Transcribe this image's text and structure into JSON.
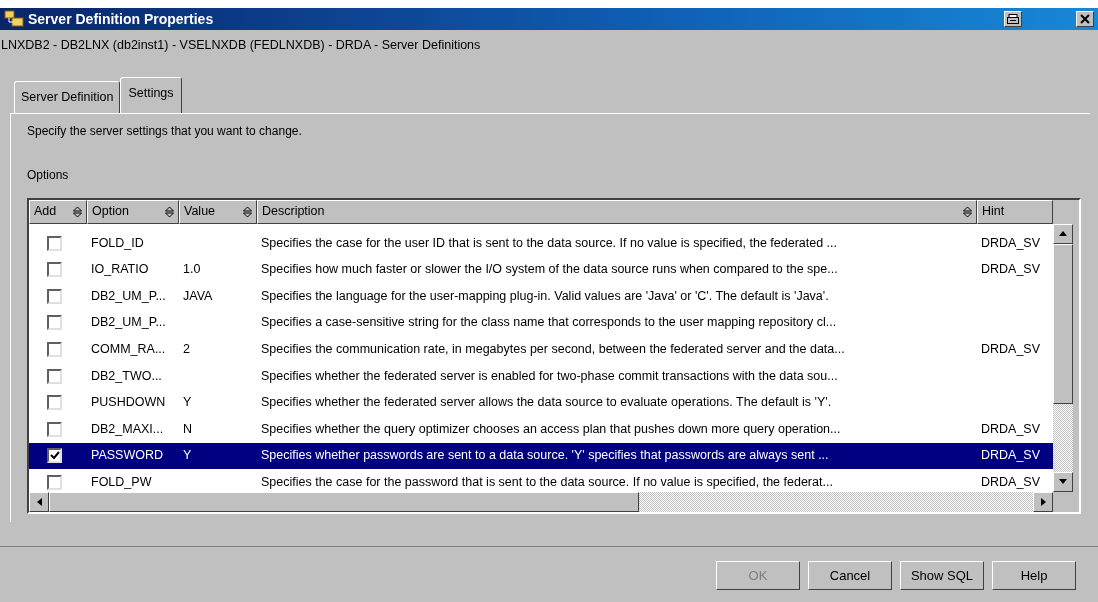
{
  "window": {
    "title": "Server Definition Properties",
    "subtitle": "LNXDB2 - DB2LNX (db2inst1)  - VSELNXDB (FEDLNXDB) - DRDA - Server Definitions"
  },
  "tabs": [
    {
      "label": "Server Definition",
      "selected": false
    },
    {
      "label": "Settings",
      "selected": true
    }
  ],
  "instruction": "Specify the server settings that you want to change.",
  "options_label": "Options",
  "table": {
    "columns": [
      {
        "label": "Add",
        "sortable": true
      },
      {
        "label": "Option",
        "sortable": true
      },
      {
        "label": "Value",
        "sortable": true
      },
      {
        "label": "Description",
        "sortable": true
      },
      {
        "label": "Hint",
        "sortable": false
      }
    ],
    "rows": [
      {
        "checked": false,
        "selected": false,
        "option": "FOLD_ID",
        "description": "Specifies the case for the  user ID that is sent to the data source. If no value is specified, the federated ...",
        "hint": "DRDA_SV"
      },
      {
        "checked": false,
        "selected": false,
        "option": "IO_RATIO",
        "value": "1.0",
        "description": "Specifies how much faster or slower the I/O system of the data source runs when compared to the spe...",
        "hint": "DRDA_SV"
      },
      {
        "checked": false,
        "selected": false,
        "option": "DB2_UM_P...",
        "value": "JAVA",
        "description": "Specifies the language for the user-mapping plug-in. Valid values are 'Java' or 'C'. The default is 'Java'."
      },
      {
        "checked": false,
        "selected": false,
        "option": "DB2_UM_P...",
        "description": "Specifies a case-sensitive string for the class name that corresponds to the user mapping repository cl..."
      },
      {
        "checked": false,
        "selected": false,
        "option": "COMM_RA...",
        "value": "2",
        "description": "Specifies the communication rate, in megabytes per second, between the federated server and the data...",
        "hint": "DRDA_SV"
      },
      {
        "checked": false,
        "selected": false,
        "option": "DB2_TWO...",
        "description": "Specifies whether the federated server is enabled for two-phase commit transactions with the data sou..."
      },
      {
        "checked": false,
        "selected": false,
        "option": "PUSHDOWN",
        "value": "Y",
        "description": "Specifies whether the federated server allows the data source  to evaluate operations.  The default is 'Y'."
      },
      {
        "checked": false,
        "selected": false,
        "option": "DB2_MAXI...",
        "value": "N",
        "description": "Specifies whether the query optimizer chooses an access plan that pushes down more query operation...",
        "hint": "DRDA_SV"
      },
      {
        "checked": true,
        "selected": true,
        "option": "PASSWORD",
        "value": "Y",
        "description": "Specifies whether passwords are sent to a data source. 'Y' specifies that passwords are always sent ...",
        "hint": "DRDA_SV"
      },
      {
        "checked": false,
        "selected": false,
        "option": "FOLD_PW",
        "description": "Specifies the case for the  password that is sent to the data source. If no value is specified, the federat...",
        "hint": "DRDA_SV"
      }
    ]
  },
  "buttons": [
    {
      "label": "OK",
      "disabled": true
    },
    {
      "label": "Cancel",
      "disabled": false
    },
    {
      "label": "Show SQL",
      "disabled": false
    },
    {
      "label": "Help",
      "disabled": false
    }
  ]
}
